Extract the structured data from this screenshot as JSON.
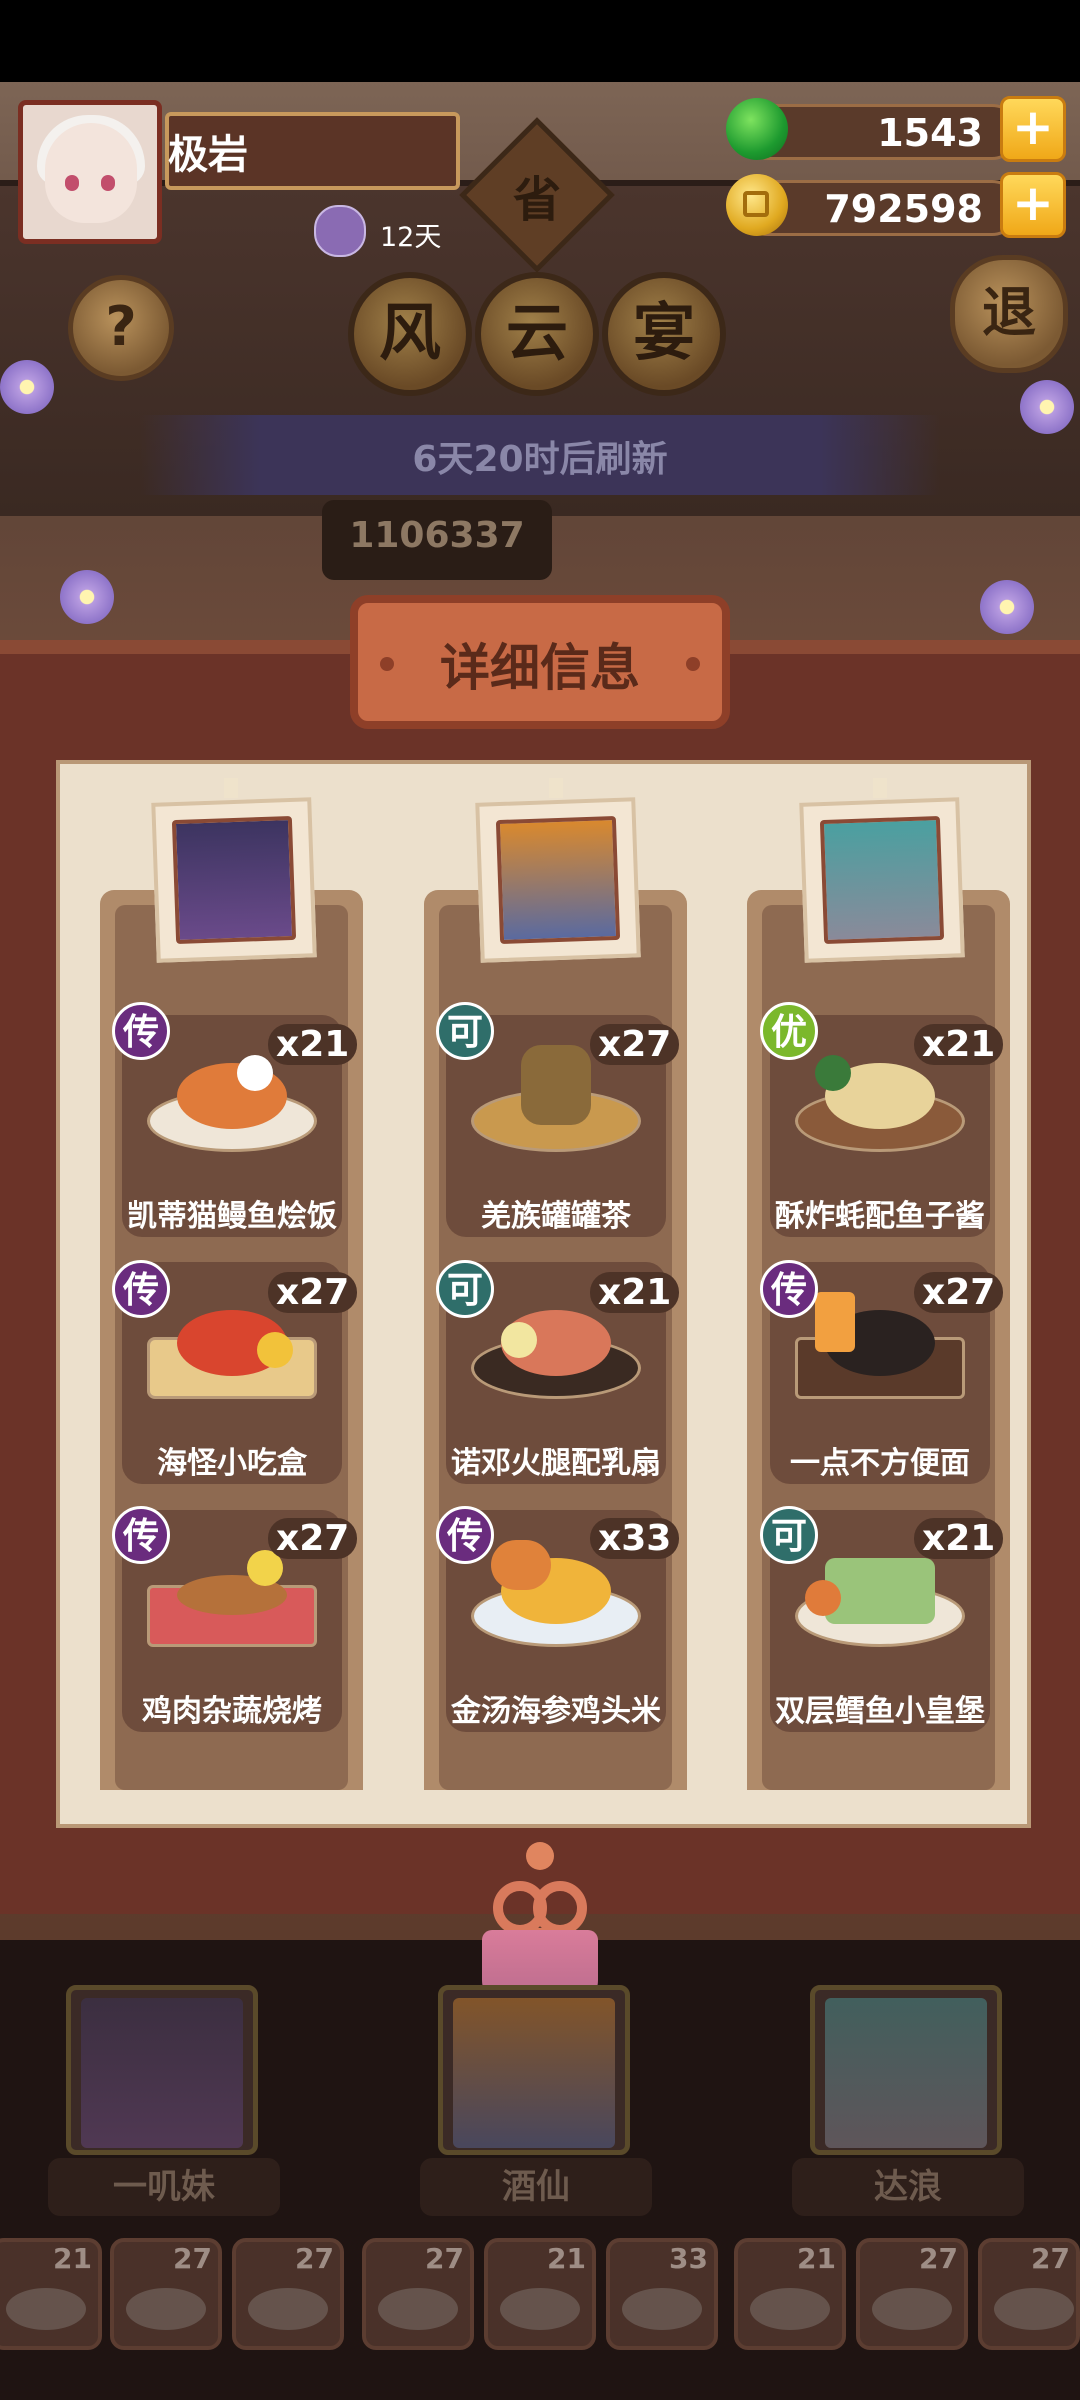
{
  "header": {
    "player_name": "极岩",
    "days": "12天",
    "jade": "1543",
    "coins": "792598",
    "sheng_label": "省",
    "exit_label": "退",
    "help_label": "?"
  },
  "event": {
    "title_chars": [
      "风",
      "云",
      "宴"
    ],
    "refresh_text": "6天20时后刷新",
    "score": "1106337"
  },
  "panel": {
    "title": "详细信息",
    "columns": [
      {
        "dishes": [
          {
            "rank": "传",
            "count": "x21",
            "name": "凯蒂猫鳗鱼烩饭"
          },
          {
            "rank": "传",
            "count": "x27",
            "name": "海怪小吃盒"
          },
          {
            "rank": "传",
            "count": "x27",
            "name": "鸡肉杂蔬烧烤"
          }
        ]
      },
      {
        "dishes": [
          {
            "rank": "可",
            "count": "x27",
            "name": "羌族罐罐茶"
          },
          {
            "rank": "可",
            "count": "x21",
            "name": "诺邓火腿配乳扇"
          },
          {
            "rank": "传",
            "count": "x33",
            "name": "金汤海参鸡头米"
          }
        ]
      },
      {
        "dishes": [
          {
            "rank": "优",
            "count": "x21",
            "name": "酥炸蚝配鱼子酱"
          },
          {
            "rank": "传",
            "count": "x27",
            "name": "一点不方便面"
          },
          {
            "rank": "可",
            "count": "x21",
            "name": "双层鳕鱼小皇堡"
          }
        ]
      }
    ]
  },
  "characters": [
    "一叽妹",
    "酒仙",
    "达浪"
  ],
  "dish_slots": [
    "21",
    "27",
    "27",
    "27",
    "21",
    "33",
    "21",
    "27",
    "27"
  ],
  "colors": {
    "rank_legend": "#6a2c7e",
    "rank_can": "#2f6e6a",
    "rank_good": "#7bb82c",
    "board": "#ece0cc",
    "frame": "#6b3328"
  }
}
